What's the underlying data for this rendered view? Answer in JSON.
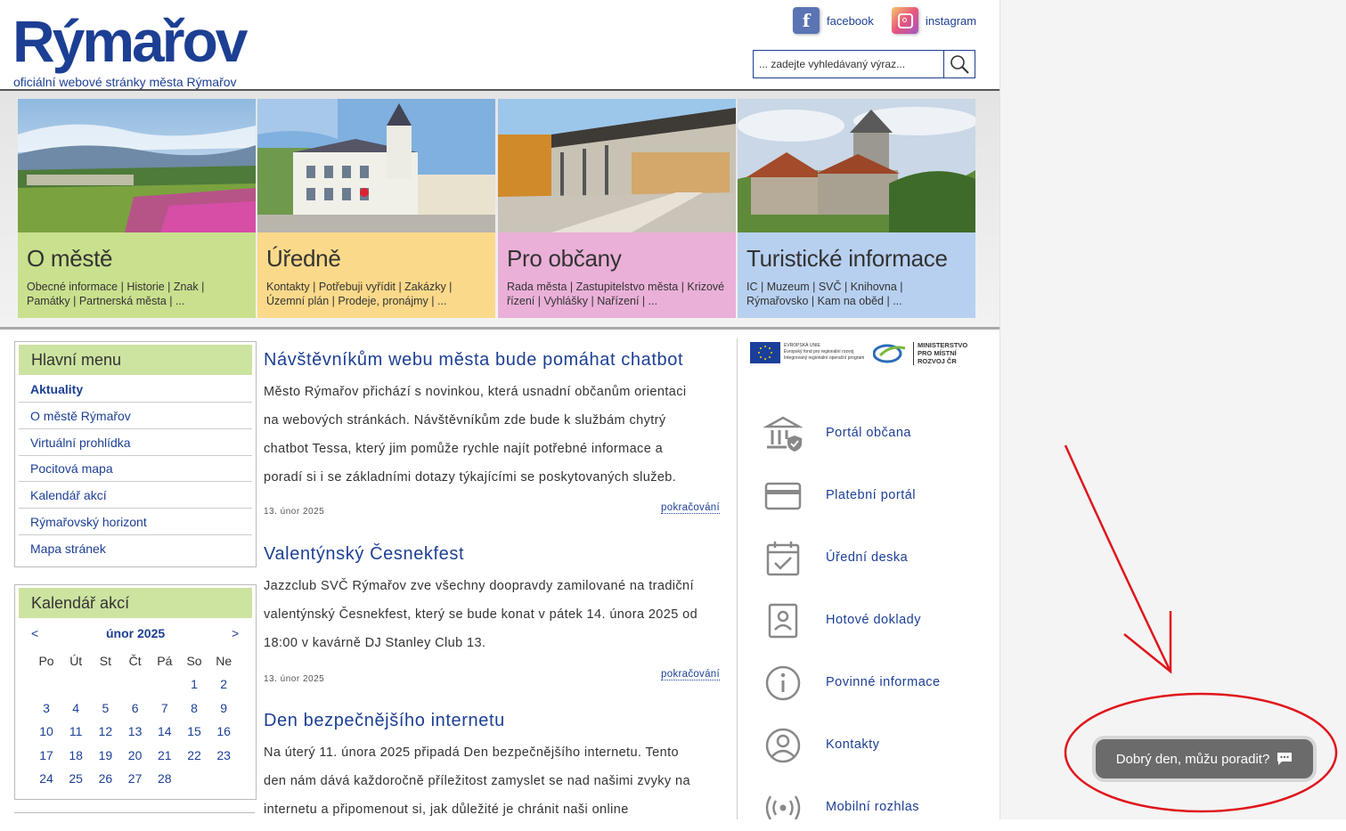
{
  "site": {
    "logo_text": "Rýmařov",
    "logo_subtitle": "oficiální webové stránky města Rýmařov"
  },
  "social": {
    "facebook_label": "facebook",
    "instagram_label": "instagram"
  },
  "search": {
    "placeholder": "... zadejte vyhledávaný výraz..."
  },
  "tiles": [
    {
      "title": "O městě",
      "links": "Obecné informace | Historie | Znak | Památky | Partnerská města | ...",
      "color": "#c9e08e"
    },
    {
      "title": "Úředně",
      "links": "Kontakty  |  Potřebuji vyřídit  |  Zakázky  |  Územní plán  |  Prodeje, pronájmy  | ...",
      "color": "#fbd98a"
    },
    {
      "title": "Pro občany",
      "links": "Rada města  |  Zastupitelstvo města  |  Krizové řízení  |  Vyhlášky  |  Nařízení  | ...",
      "color": "#eab0d8"
    },
    {
      "title": "Turistické informace",
      "links": "IC  |  Muzeum  | SVČ  |  Knihovna  |  Rýmařovsko  |  Kam na oběd  | ...",
      "color": "#b7d0f0"
    }
  ],
  "main_menu": {
    "title": "Hlavní menu",
    "items": [
      "Aktuality",
      "O městě Rýmařov",
      "Virtuální prohlídka",
      "Pocitová mapa",
      "Kalendář akcí",
      "Rýmařovský horizont",
      "Mapa stránek"
    ]
  },
  "calendar": {
    "title": "Kalendář akcí",
    "prev": "<",
    "next": ">",
    "month": "únor 2025",
    "weekdays": [
      "Po",
      "Út",
      "St",
      "Čt",
      "Pá",
      "So",
      "Ne"
    ],
    "weeks": [
      [
        "",
        "",
        "",
        "",
        "",
        "1",
        "2"
      ],
      [
        "3",
        "4",
        "5",
        "6",
        "7",
        "8",
        "9"
      ],
      [
        "10",
        "11",
        "12",
        "13",
        "14",
        "15",
        "16"
      ],
      [
        "17",
        "18",
        "19",
        "20",
        "21",
        "22",
        "23"
      ],
      [
        "24",
        "25",
        "26",
        "27",
        "28",
        "",
        ""
      ]
    ]
  },
  "articles": [
    {
      "title": "Návštěvníkům webu města bude pomáhat chatbot",
      "lines": [
        "Město Rýmařov přichází s novinkou, která usnadní občanům orientaci",
        "na webových stránkách. Návštěvníkům zde bude k službám chytrý",
        "chatbot Tessa, který jim pomůže rychle najít potřebné informace a",
        "poradí si i se základními dotazy týkajícími se poskytovaných služeb."
      ],
      "date": "13. únor 2025",
      "more": "pokračování"
    },
    {
      "title": "Valentýnský Česnekfest",
      "lines": [
        "Jazzclub SVČ Rýmařov zve všechny doopravdy zamilované na tradiční",
        "valentýnský Česnekfest, který se bude konat v pátek 14. února 2025 od",
        "18:00 v kavárně DJ Stanley Club 13."
      ],
      "date": "13. únor 2025",
      "more": "pokračování"
    },
    {
      "title": "Den bezpečnějšího internetu",
      "lines": [
        "Na úterý 11. února 2025 připadá Den bezpečnějšího internetu. Tento",
        "den nám dává každoročně příležitost zamyslet se nad našimi zvyky na",
        "internetu a připomenout si, jak důležité je chránit naši online"
      ],
      "date": "",
      "more": ""
    }
  ],
  "eu_logos": {
    "eu_line1": "EVROPSKÁ UNIE",
    "eu_line2": "Evropský fond pro regionální rozvoj",
    "eu_line3": "Integrovaný regionální operační program",
    "ministry_line1": "MINISTERSTVO",
    "ministry_line2": "PRO MÍSTNÍ",
    "ministry_line3": "ROZVOJ ČR"
  },
  "services": [
    {
      "label": "Portál občana",
      "icon": "building-shield-icon"
    },
    {
      "label": "Platební portál",
      "icon": "card-icon"
    },
    {
      "label": "Úřední deska",
      "icon": "calendar-check-icon"
    },
    {
      "label": "Hotové doklady",
      "icon": "id-document-icon"
    },
    {
      "label": "Povinné informace",
      "icon": "info-icon"
    },
    {
      "label": "Kontakty",
      "icon": "user-circle-icon"
    },
    {
      "label": "Mobilní rozhlas",
      "icon": "broadcast-icon"
    }
  ],
  "chat": {
    "greeting": "Dobrý den, můžu poradit?",
    "icon": "chat-icon"
  },
  "colors": {
    "brand_blue": "#1c3f94",
    "annotation_red": "#e0151c"
  }
}
